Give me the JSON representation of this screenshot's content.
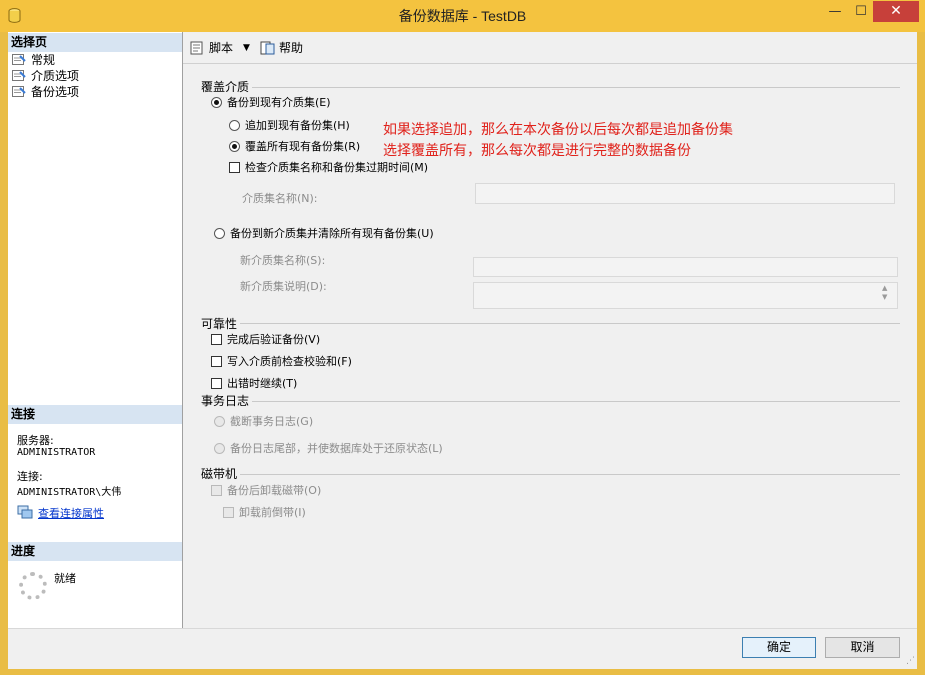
{
  "window": {
    "title": "备份数据库 - TestDB"
  },
  "left": {
    "select_page_header": "选择页",
    "pages": [
      "常规",
      "介质选项",
      "备份选项"
    ],
    "connection_header": "连接",
    "server_label": "服务器:",
    "server_value": "ADMINISTRATOR",
    "connection_label": "连接:",
    "connection_value": "ADMINISTRATOR\\大伟",
    "view_props_link": "查看连接属性",
    "progress_header": "进度",
    "progress_status": "就绪"
  },
  "toolbar": {
    "script_label": "脚本",
    "help_label": "帮助"
  },
  "overwrite": {
    "label": "覆盖介质",
    "backup_existing": "备份到现有介质集(E)",
    "append": "追加到现有备份集(H)",
    "overwrite_all": "覆盖所有现有备份集(R)",
    "check_name": "检查介质集名称和备份集过期时间(M)",
    "media_set_name_label": "介质集名称(N):",
    "backup_new": "备份到新介质集并清除所有现有备份集(U)",
    "new_media_name_label": "新介质集名称(S):",
    "new_media_desc_label": "新介质集说明(D):"
  },
  "annotation": {
    "line1": "如果选择追加，那么在本次备份以后每次都是追加备份集",
    "line2": "选择覆盖所有，那么每次都是进行完整的数据备份"
  },
  "reliability": {
    "label": "可靠性",
    "verify": "完成后验证备份(V)",
    "checksum": "写入介质前检查校验和(F)",
    "continue_on_error": "出错时继续(T)"
  },
  "transaction_log": {
    "label": "事务日志",
    "truncate": "截断事务日志(G)",
    "tail": "备份日志尾部，并使数据库处于还原状态(L)"
  },
  "tape": {
    "label": "磁带机",
    "unload": "备份后卸载磁带(O)",
    "rewind": "卸载前倒带(I)"
  },
  "buttons": {
    "ok": "确定",
    "cancel": "取消"
  },
  "colors": {
    "title_bar": "#f4c33f",
    "close_button": "#c7403a",
    "annotation": "#e0221b",
    "section_header": "#d7e4f2"
  }
}
